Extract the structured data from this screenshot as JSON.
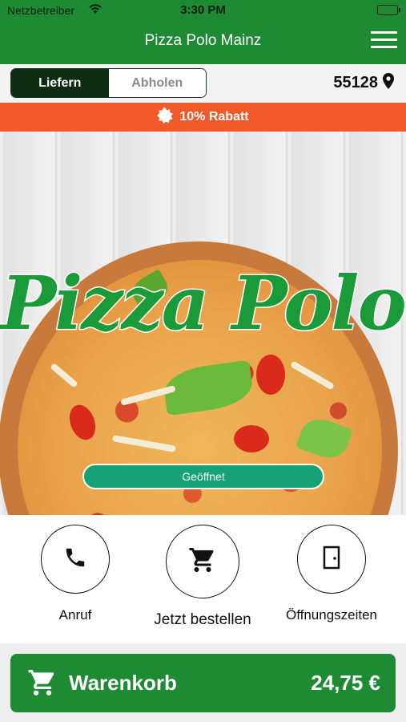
{
  "status_bar": {
    "carrier": "Netzbetreiber",
    "time": "3:30 PM",
    "icons": [
      "wifi-icon",
      "battery-icon"
    ]
  },
  "nav": {
    "title": "Pizza Polo Mainz",
    "menu_icon": "hamburger-menu-icon"
  },
  "order_type": {
    "options": [
      {
        "label": "Liefern",
        "selected": true
      },
      {
        "label": "Abholen",
        "selected": false
      }
    ],
    "zip_code": "55128",
    "zip_icon": "location-pin-icon"
  },
  "promo": {
    "text": "10% Rabatt",
    "icon": "badge-icon",
    "color": "#f05a28"
  },
  "hero": {
    "logo_text": "Pizza Polo",
    "status": "Geöffnet",
    "status_color": "#17a275"
  },
  "actions": [
    {
      "label": "Anruf",
      "icon": "phone-icon"
    },
    {
      "label": "Jetzt bestellen",
      "icon": "cart-icon"
    },
    {
      "label": "Öffnungszeiten",
      "icon": "door-icon"
    }
  ],
  "cart": {
    "label": "Warenkorb",
    "total": "24,75 €",
    "icon": "cart-icon"
  },
  "colors": {
    "brand": "#1e8a34",
    "selected_segment": "#0e2b14"
  }
}
